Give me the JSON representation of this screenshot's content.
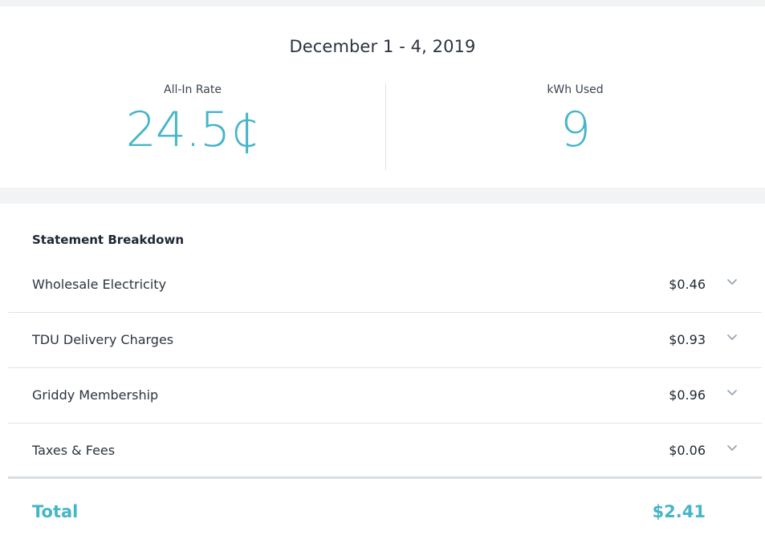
{
  "summary": {
    "period": "December 1 - 4, 2019",
    "rate_label": "All-In Rate",
    "rate_value": "24.5¢",
    "kwh_label": "kWh Used",
    "kwh_value": "9"
  },
  "breakdown": {
    "title": "Statement Breakdown",
    "items": [
      {
        "label": "Wholesale Electricity",
        "amount": "$0.46",
        "icon": "chevron-down-icon"
      },
      {
        "label": "TDU Delivery Charges",
        "amount": "$0.93",
        "icon": "chevron-down-icon"
      },
      {
        "label": "Griddy Membership",
        "amount": "$0.96",
        "icon": "chevron-down-icon"
      },
      {
        "label": "Taxes & Fees",
        "amount": "$0.06",
        "icon": "chevron-down-icon"
      }
    ],
    "total_label": "Total",
    "total_amount": "$2.41"
  },
  "colors": {
    "accent": "#45b5c8",
    "text": "#222b36",
    "divider": "#dfe3e7",
    "background": "#f2f3f5"
  }
}
